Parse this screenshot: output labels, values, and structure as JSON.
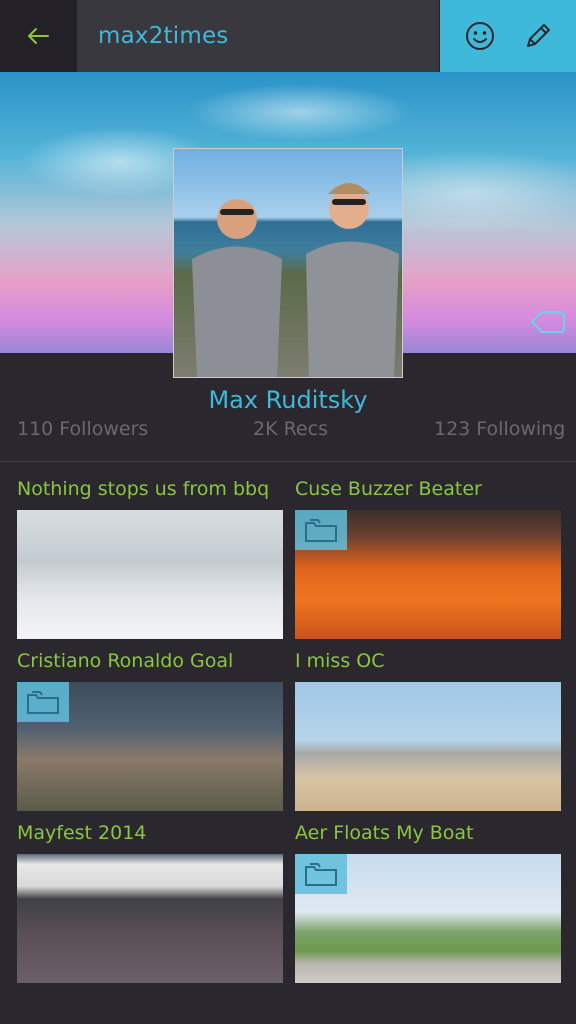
{
  "header": {
    "title": "max2times",
    "back_icon": "back-arrow-icon",
    "actions": [
      "smiley-icon",
      "pencil-icon"
    ],
    "accent_color": "#3fb9da"
  },
  "profile": {
    "name": "Max Ruditsky",
    "followers": "110 Followers",
    "recs": "2K Recs",
    "following": "123 Following"
  },
  "posts": [
    {
      "title": "Nothing stops us from bbq",
      "gallery": false
    },
    {
      "title": "Cuse Buzzer Beater",
      "gallery": true
    },
    {
      "title": "Cristiano Ronaldo Goal",
      "gallery": true
    },
    {
      "title": "I miss OC",
      "gallery": false
    },
    {
      "title": "Mayfest 2014",
      "gallery": false
    },
    {
      "title": "Aer Floats My Boat",
      "gallery": true
    }
  ],
  "colors": {
    "title_green": "#8bc63f",
    "background": "#2a282e"
  }
}
